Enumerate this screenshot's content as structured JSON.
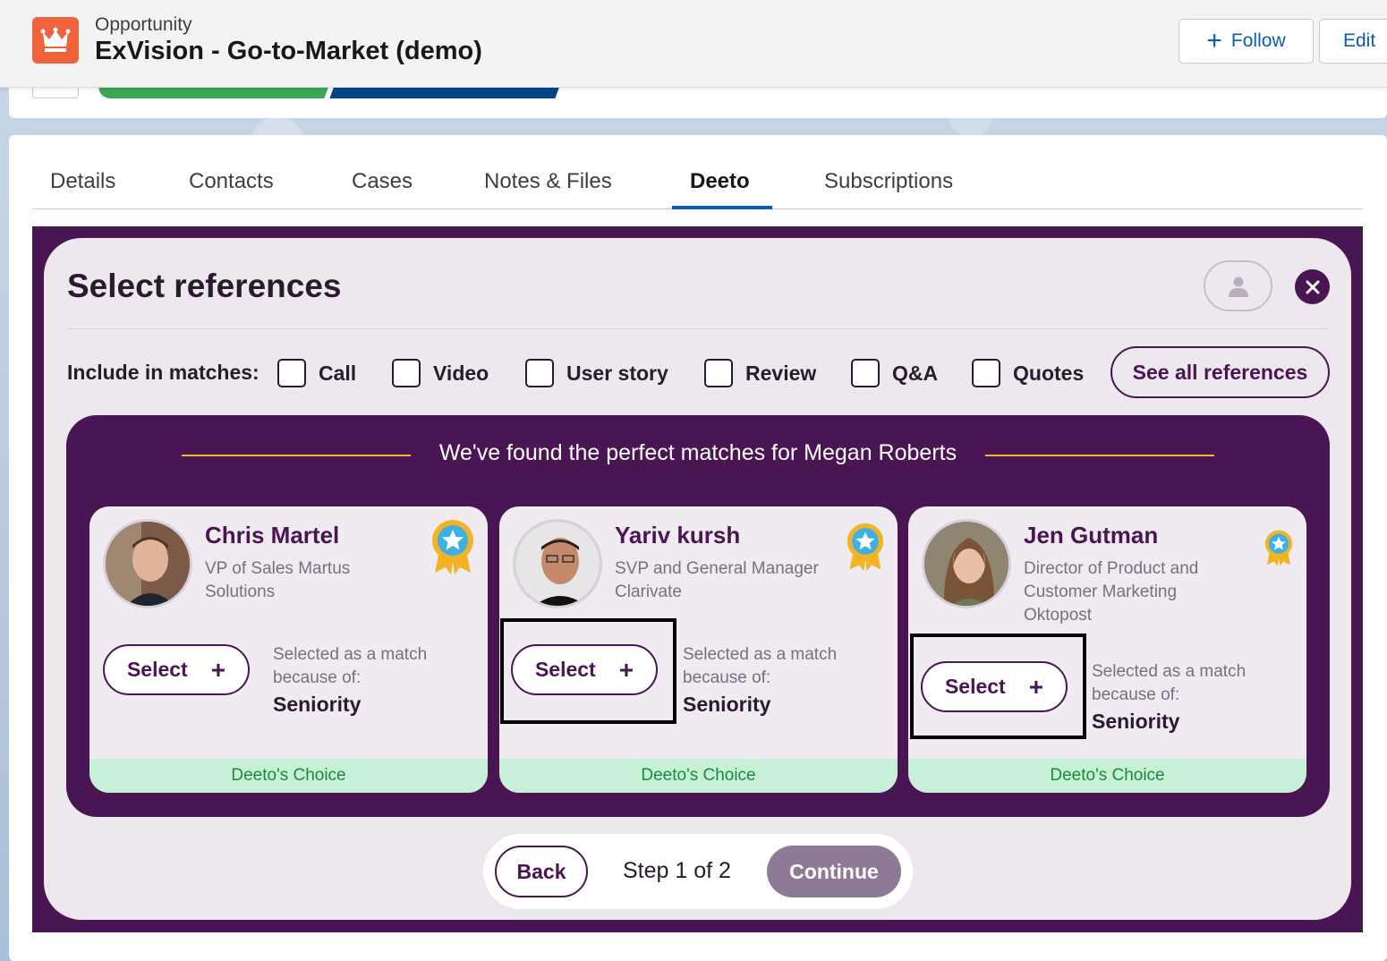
{
  "header": {
    "object_type": "Opportunity",
    "record_title": "ExVision - Go-to-Market (demo)",
    "follow_label": "Follow",
    "edit_label": "Edit"
  },
  "tabs": [
    {
      "label": "Details"
    },
    {
      "label": "Contacts"
    },
    {
      "label": "Cases"
    },
    {
      "label": "Notes & Files"
    },
    {
      "label": "Deeto",
      "active": true
    },
    {
      "label": "Subscriptions"
    }
  ],
  "panel": {
    "title": "Select references",
    "filters_label": "Include in matches:",
    "filters": [
      {
        "label": "Call",
        "checked": false
      },
      {
        "label": "Video",
        "checked": false
      },
      {
        "label": "User story",
        "checked": false
      },
      {
        "label": "Review",
        "checked": false
      },
      {
        "label": "Q&A",
        "checked": false
      },
      {
        "label": "Quotes",
        "checked": false
      }
    ],
    "see_all_label": "See all references",
    "matches_heading": "We've found the perfect matches for Megan Roberts",
    "cards": [
      {
        "name": "Chris Martel",
        "role_line1": "VP of Sales Martus",
        "role_line2": "Solutions",
        "role_line3": "",
        "select_label": "Select",
        "reason_label": "Selected as a match because of:",
        "reason_value": "Seniority",
        "choice_label": "Deeto's Choice"
      },
      {
        "name": "Yariv kursh",
        "role_line1": "SVP and General Manager",
        "role_line2": "Clarivate",
        "role_line3": "",
        "select_label": "Select",
        "reason_label": "Selected as a match because of:",
        "reason_value": "Seniority",
        "choice_label": "Deeto's Choice"
      },
      {
        "name": "Jen Gutman",
        "role_line1": "Director of Product and",
        "role_line2": "Customer Marketing",
        "role_line3": "Oktopost",
        "select_label": "Select",
        "reason_label": "Selected as a match because of:",
        "reason_value": "Seniority",
        "choice_label": "Deeto's Choice"
      }
    ],
    "footer": {
      "back_label": "Back",
      "step_text": "Step 1 of 2",
      "continue_label": "Continue"
    }
  },
  "colors": {
    "brand_purple": "#4a1553",
    "accent_gold": "#f0b62a",
    "choice_green": "#1b8a3d",
    "salesforce_blue": "#0b5cab",
    "app_icon_orange": "#f0623c"
  }
}
